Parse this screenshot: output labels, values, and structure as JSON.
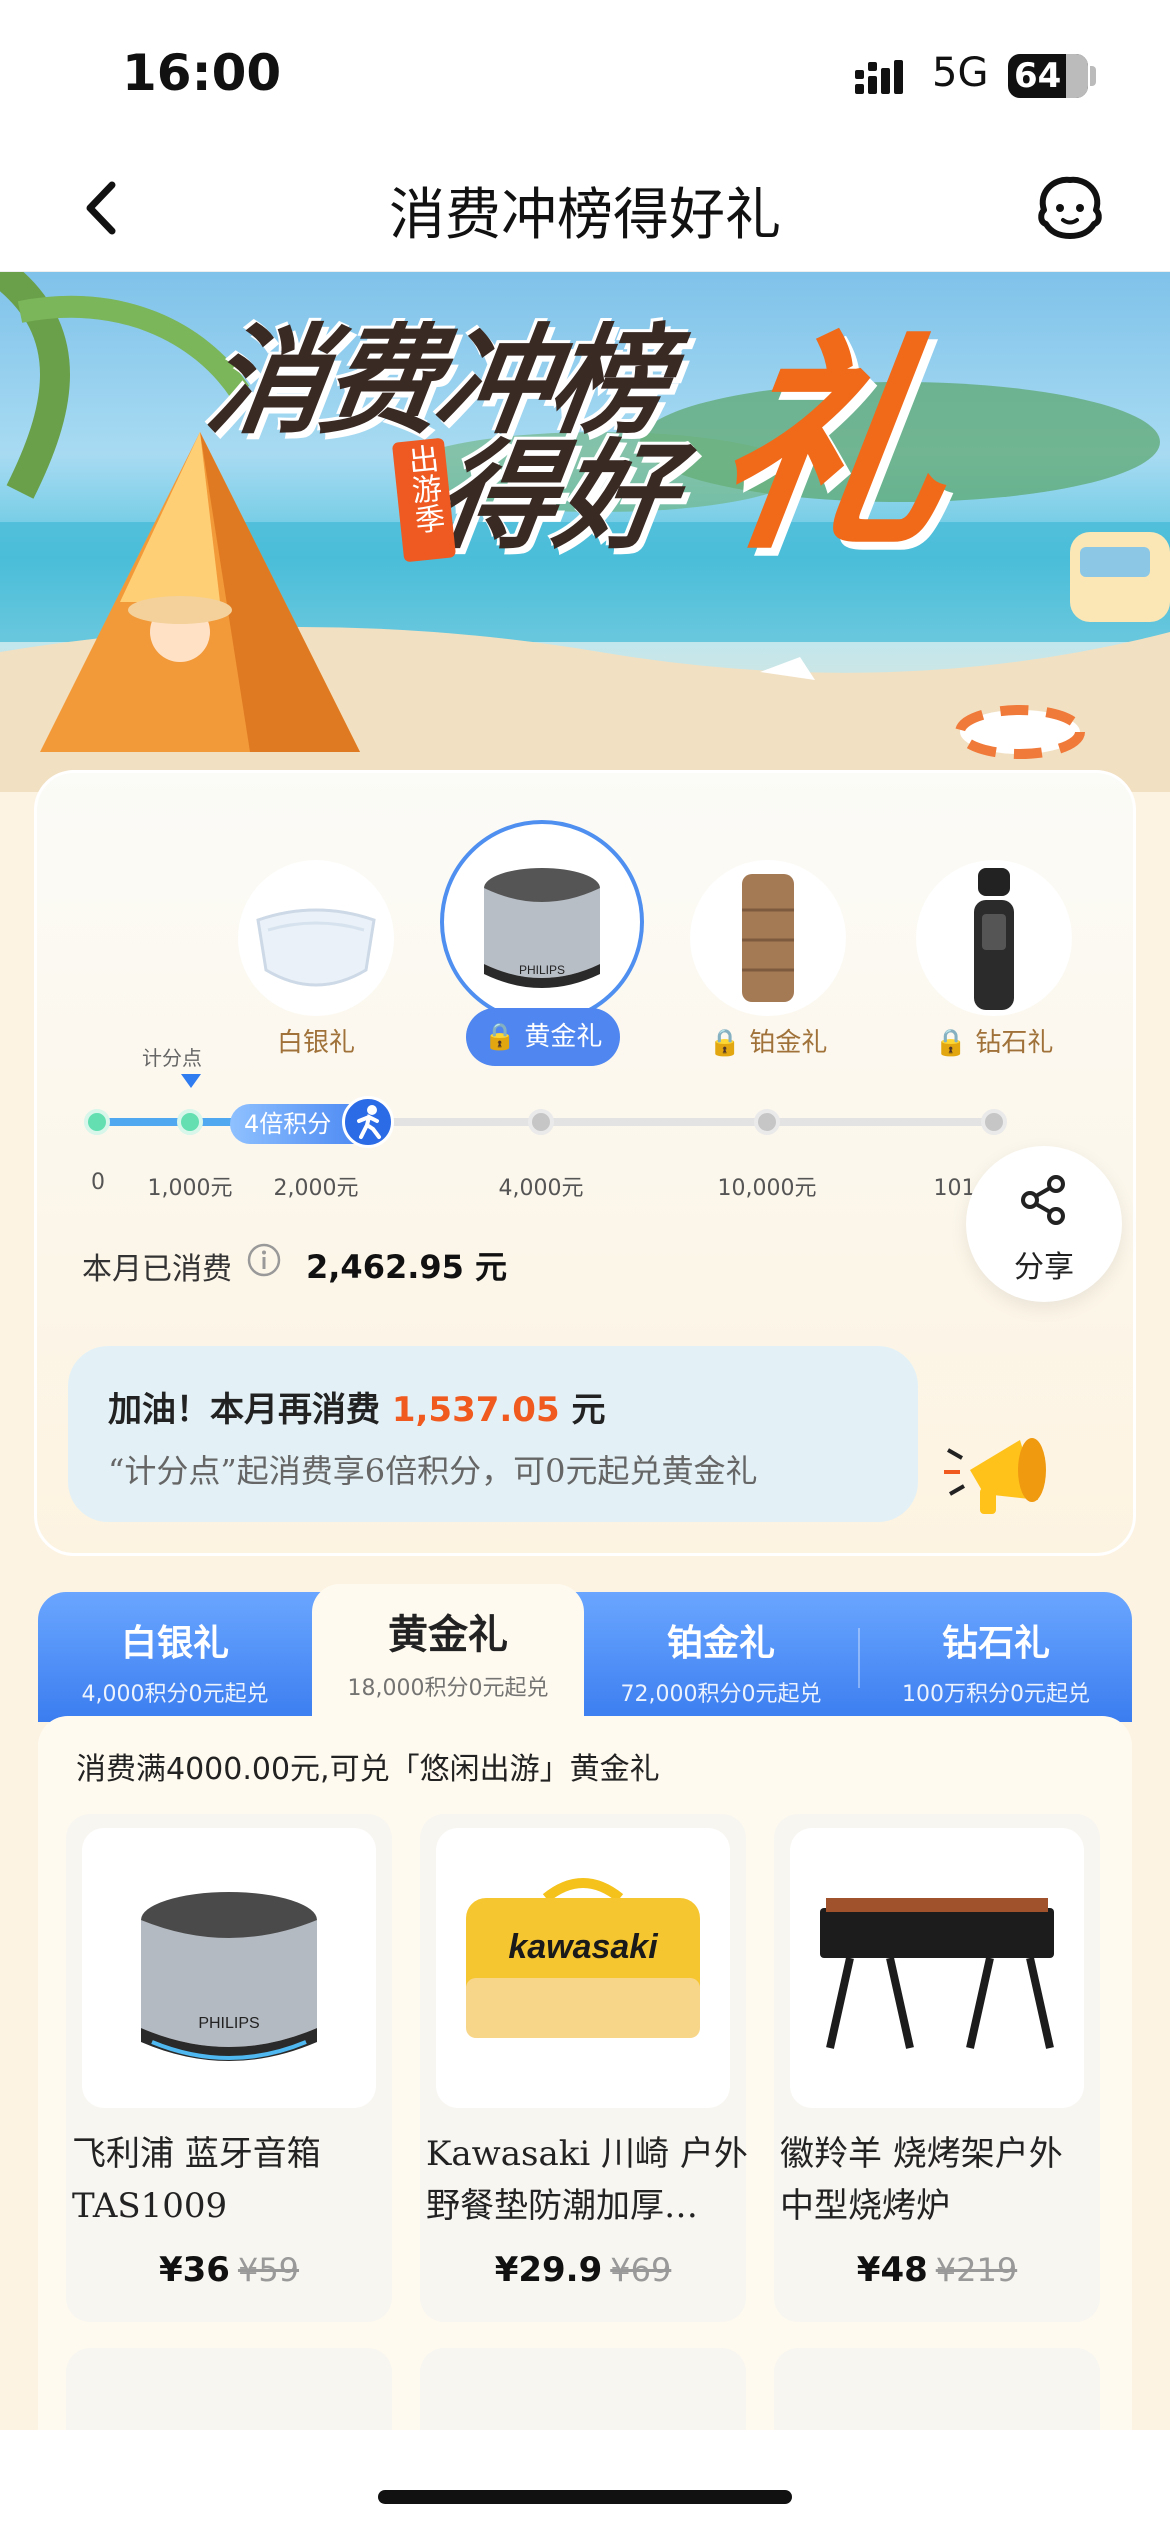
{
  "status": {
    "time": "16:00",
    "network": "5G",
    "battery": "64"
  },
  "nav": {
    "title": "消费冲榜得好礼"
  },
  "hero": {
    "title_line1": "消费冲榜",
    "title_line2": "得好",
    "title_big": "礼",
    "season_tag": "出游季"
  },
  "gifts": [
    {
      "label": "白银礼",
      "locked": false
    },
    {
      "label": "黄金礼",
      "locked": true,
      "active": true
    },
    {
      "label": "铂金礼",
      "locked": true
    },
    {
      "label": "钻石礼",
      "locked": true
    }
  ],
  "progress": {
    "score_point_label": "计分点",
    "bonus_label": "4倍积分",
    "ticks": [
      "0",
      "1,000元",
      "2,000元",
      "4,000元",
      "10,000元",
      "101,000元"
    ]
  },
  "spent": {
    "label": "本月已消费",
    "value": "2,462.95 元"
  },
  "share": {
    "label": "分享"
  },
  "tip": {
    "prefix": "加油！本月再消费 ",
    "amount": "1,537.05",
    "suffix": " 元",
    "line2": "“计分点”起消费享6倍积分，可0元起兑黄金礼"
  },
  "tabs": [
    {
      "name": "白银礼",
      "sub": "4,000积分0元起兑"
    },
    {
      "name": "黄金礼",
      "sub": "18,000积分0元起兑"
    },
    {
      "name": "铂金礼",
      "sub": "72,000积分0元起兑"
    },
    {
      "name": "钻石礼",
      "sub": "100万积分0元起兑"
    }
  ],
  "panel": {
    "desc": "消费满4000.00元,可兑「悠闲出游」黄金礼"
  },
  "products": [
    {
      "name_l1": "飞利浦 蓝牙音箱",
      "name_l2": "TAS1009",
      "price": "¥36",
      "orig": "¥59",
      "img_label": "PHILIPS"
    },
    {
      "name_l1": "Kawasaki 川崎 户外",
      "name_l2": "野餐垫防潮加厚…",
      "price": "¥29.9",
      "orig": "¥69",
      "img_label": "kawasaki"
    },
    {
      "name_l1": "徽羚羊 烧烤架户外",
      "name_l2": "中型烧烤炉",
      "price": "¥48",
      "orig": "¥219",
      "img_label": ""
    }
  ],
  "colors": {
    "accent_blue": "#3b7df0",
    "accent_orange": "#f05a1e",
    "gift_gold": "#a0723a"
  }
}
